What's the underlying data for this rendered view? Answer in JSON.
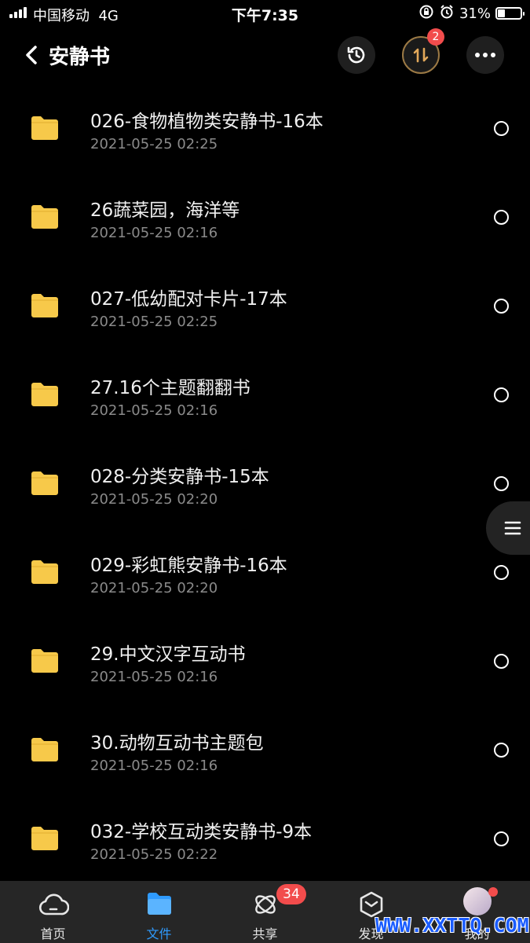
{
  "status_bar": {
    "carrier": "中国移动",
    "network": "4G",
    "time": "下午7:35",
    "battery_text": "31%",
    "battery_level": 0.31
  },
  "nav": {
    "title": "安静书",
    "transfer_badge": "2"
  },
  "files": [
    {
      "name": "026-食物植物类安静书-16本",
      "date": "2021-05-25 02:25"
    },
    {
      "name": "26蔬菜园，海洋等",
      "date": "2021-05-25 02:16"
    },
    {
      "name": "027-低幼配对卡片-17本",
      "date": "2021-05-25 02:25"
    },
    {
      "name": "27.16个主题翻翻书",
      "date": "2021-05-25 02:16"
    },
    {
      "name": "028-分类安静书-15本",
      "date": "2021-05-25 02:20"
    },
    {
      "name": "029-彩虹熊安静书-16本",
      "date": "2021-05-25 02:20"
    },
    {
      "name": "29.中文汉字互动书",
      "date": "2021-05-25 02:16"
    },
    {
      "name": "30.动物互动书主题包",
      "date": "2021-05-25 02:16"
    },
    {
      "name": "032-学校互动类安静书-9本",
      "date": "2021-05-25 02:22"
    }
  ],
  "tabs": [
    {
      "label": "首页",
      "icon": "cloud-icon"
    },
    {
      "label": "文件",
      "icon": "folder-icon"
    },
    {
      "label": "共享",
      "icon": "orbit-icon",
      "badge": "34"
    },
    {
      "label": "发现",
      "icon": "box-icon"
    },
    {
      "label": "我的",
      "icon": "avatar"
    }
  ],
  "watermark": "WWW.XXTTQ.COM",
  "colors": {
    "background": "#000000",
    "folder": "#f7c94a",
    "accent": "#2f9bff",
    "badge": "#f24c4c"
  }
}
